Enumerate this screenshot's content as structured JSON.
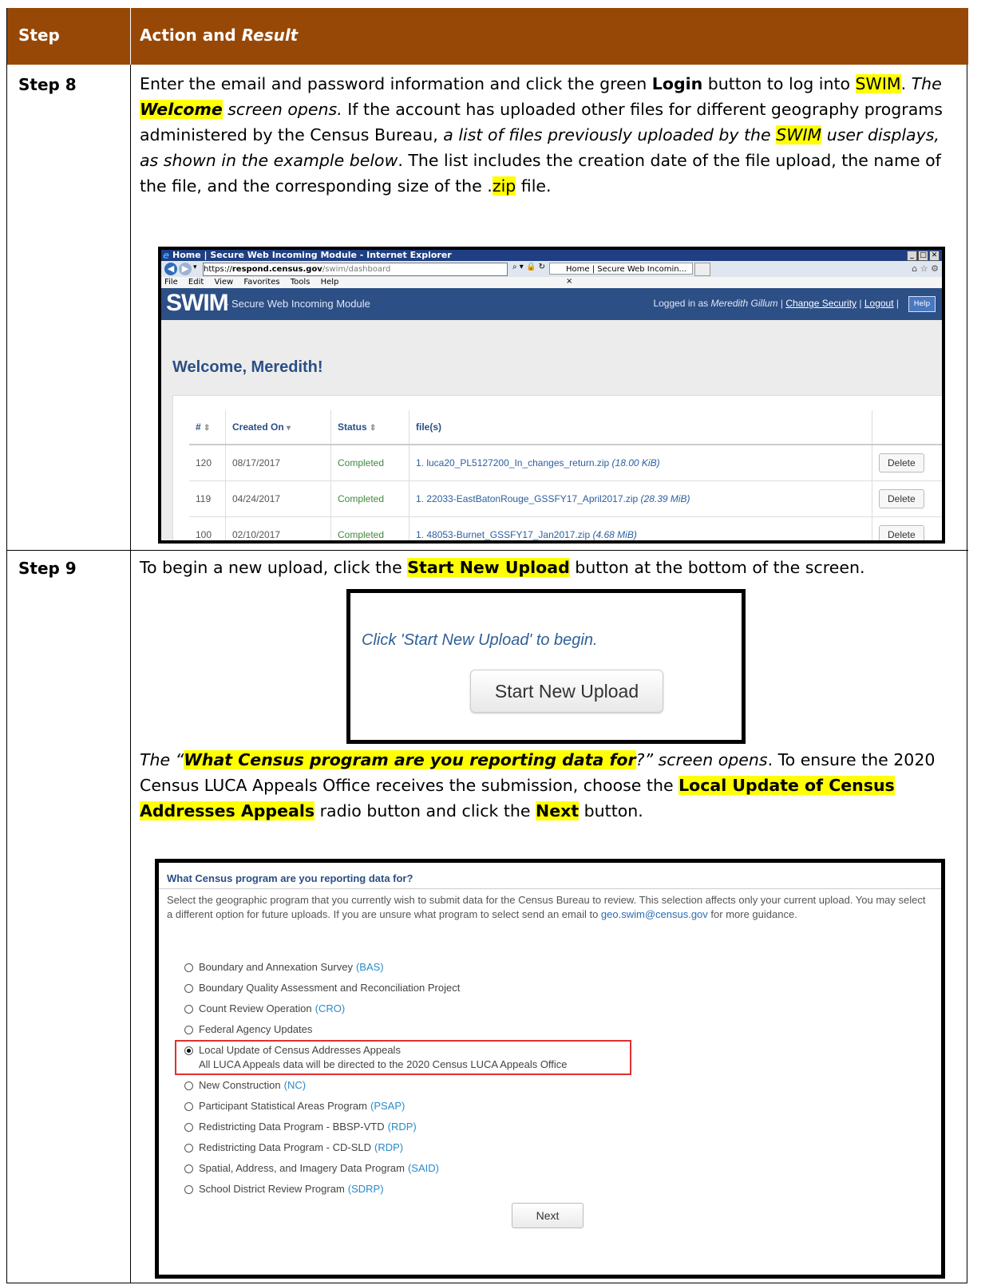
{
  "table": {
    "header": {
      "step": "Step",
      "action": "Action and ",
      "action_italic": "Result"
    }
  },
  "step8": {
    "label": "Step 8",
    "text": {
      "p1": "Enter the email and password information and click the green ",
      "login": "Login",
      "p2": " button to log into ",
      "swim1": "SWIM",
      "p3": ". ",
      "the": "The ",
      "welcome": "Welcome",
      "screen_opens": " screen opens.",
      "p4": " If the account has uploaded other files for different geography programs administered by the Census Bureau, ",
      "list_italic1": "a list of files previously uploaded by the ",
      "swim2": "SWIM",
      "list_italic2": " user displays, as shown in the example below",
      "p5": ". The list includes the creation date of the file upload, the name of the file, and the corresponding size of the .",
      "zip": "zip",
      "p6": " file."
    },
    "browser": {
      "window_title": "Home | Secure Web Incoming Module - Internet Explorer",
      "url_prefix": "https://",
      "url_domain": "respond.census.gov",
      "url_path": "/swim/dashboard",
      "tab_title": "Home | Secure Web Incomin...",
      "menu": [
        "File",
        "Edit",
        "View",
        "Favorites",
        "Tools",
        "Help"
      ],
      "logo": "SWIM",
      "subtitle": "- Secure Web Incoming Module",
      "logged_in_as": "Logged in as ",
      "user": "Meredith Gillum",
      "change_security": "Change Security",
      "logout": "Logout",
      "help": "Help",
      "welcome": "Welcome, Meredith!",
      "columns": [
        "#",
        "Created On",
        "Status",
        "file(s)"
      ],
      "rows": [
        {
          "id": "120",
          "date": "08/17/2017",
          "status": "Completed",
          "file": "1.  luca20_PL5127200_In_changes_return.zip",
          "size": "(18.00 KiB)",
          "action": "Delete"
        },
        {
          "id": "119",
          "date": "04/24/2017",
          "status": "Completed",
          "file": "1.  22033-EastBatonRouge_GSSFY17_April2017.zip",
          "size": "(28.39 MiB)",
          "action": "Delete"
        },
        {
          "id": "100",
          "date": "02/10/2017",
          "status": "Completed",
          "file": "1.  48053-Burnet_GSSFY17_Jan2017.zip",
          "size": "(4.68 MiB)",
          "action": "Delete"
        }
      ]
    }
  },
  "step9": {
    "label": "Step 9",
    "text": {
      "p1": "To begin a new upload, click the ",
      "start": "Start New Upload",
      "p2": " button at the bottom of the screen.",
      "the": "The “",
      "what": "What Census program are you reporting data for",
      "q_end": "?” screen opens",
      "p3": ". To ensure the 2020 Census LUCA Appeals Office receives the submission, choose the ",
      "luca": "Local Update of Census Addresses Appeals",
      "p4": " radio button and click the ",
      "next": "Next",
      "p5": " button."
    },
    "start_box": {
      "prompt": "Click 'Start New Upload' to begin.",
      "button": "Start New Upload"
    },
    "program_box": {
      "title": "What Census program are you reporting data for?",
      "desc1": "Select the geographic program that you currently wish to submit data for the Census Bureau to review. This selection affects only your current upload. You may select a different option for future uploads. If you are unsure what program to select send an email to ",
      "email": "geo.swim@census.gov",
      "desc2": " for more guidance.",
      "options": [
        {
          "label": "Boundary and Annexation Survey",
          "abbr": "(BAS)"
        },
        {
          "label": "Boundary Quality Assessment and Reconciliation Project",
          "abbr": ""
        },
        {
          "label": "Count Review Operation",
          "abbr": "(CRO)"
        },
        {
          "label": "Federal Agency Updates",
          "abbr": ""
        },
        {
          "label": "Local Update of Census Addresses Appeals",
          "abbr": "",
          "selected": true,
          "note": "All LUCA Appeals data will be directed to the 2020 Census LUCA Appeals Office"
        },
        {
          "label": "New Construction",
          "abbr": "(NC)"
        },
        {
          "label": "Participant Statistical Areas Program",
          "abbr": "(PSAP)"
        },
        {
          "label": "Redistricting Data Program - BBSP-VTD",
          "abbr": "(RDP)"
        },
        {
          "label": "Redistricting Data Program - CD-SLD",
          "abbr": "(RDP)"
        },
        {
          "label": "Spatial, Address, and Imagery Data Program",
          "abbr": "(SAID)"
        },
        {
          "label": "School District Review Program",
          "abbr": "(SDRP)"
        }
      ],
      "next_button": "Next"
    }
  }
}
